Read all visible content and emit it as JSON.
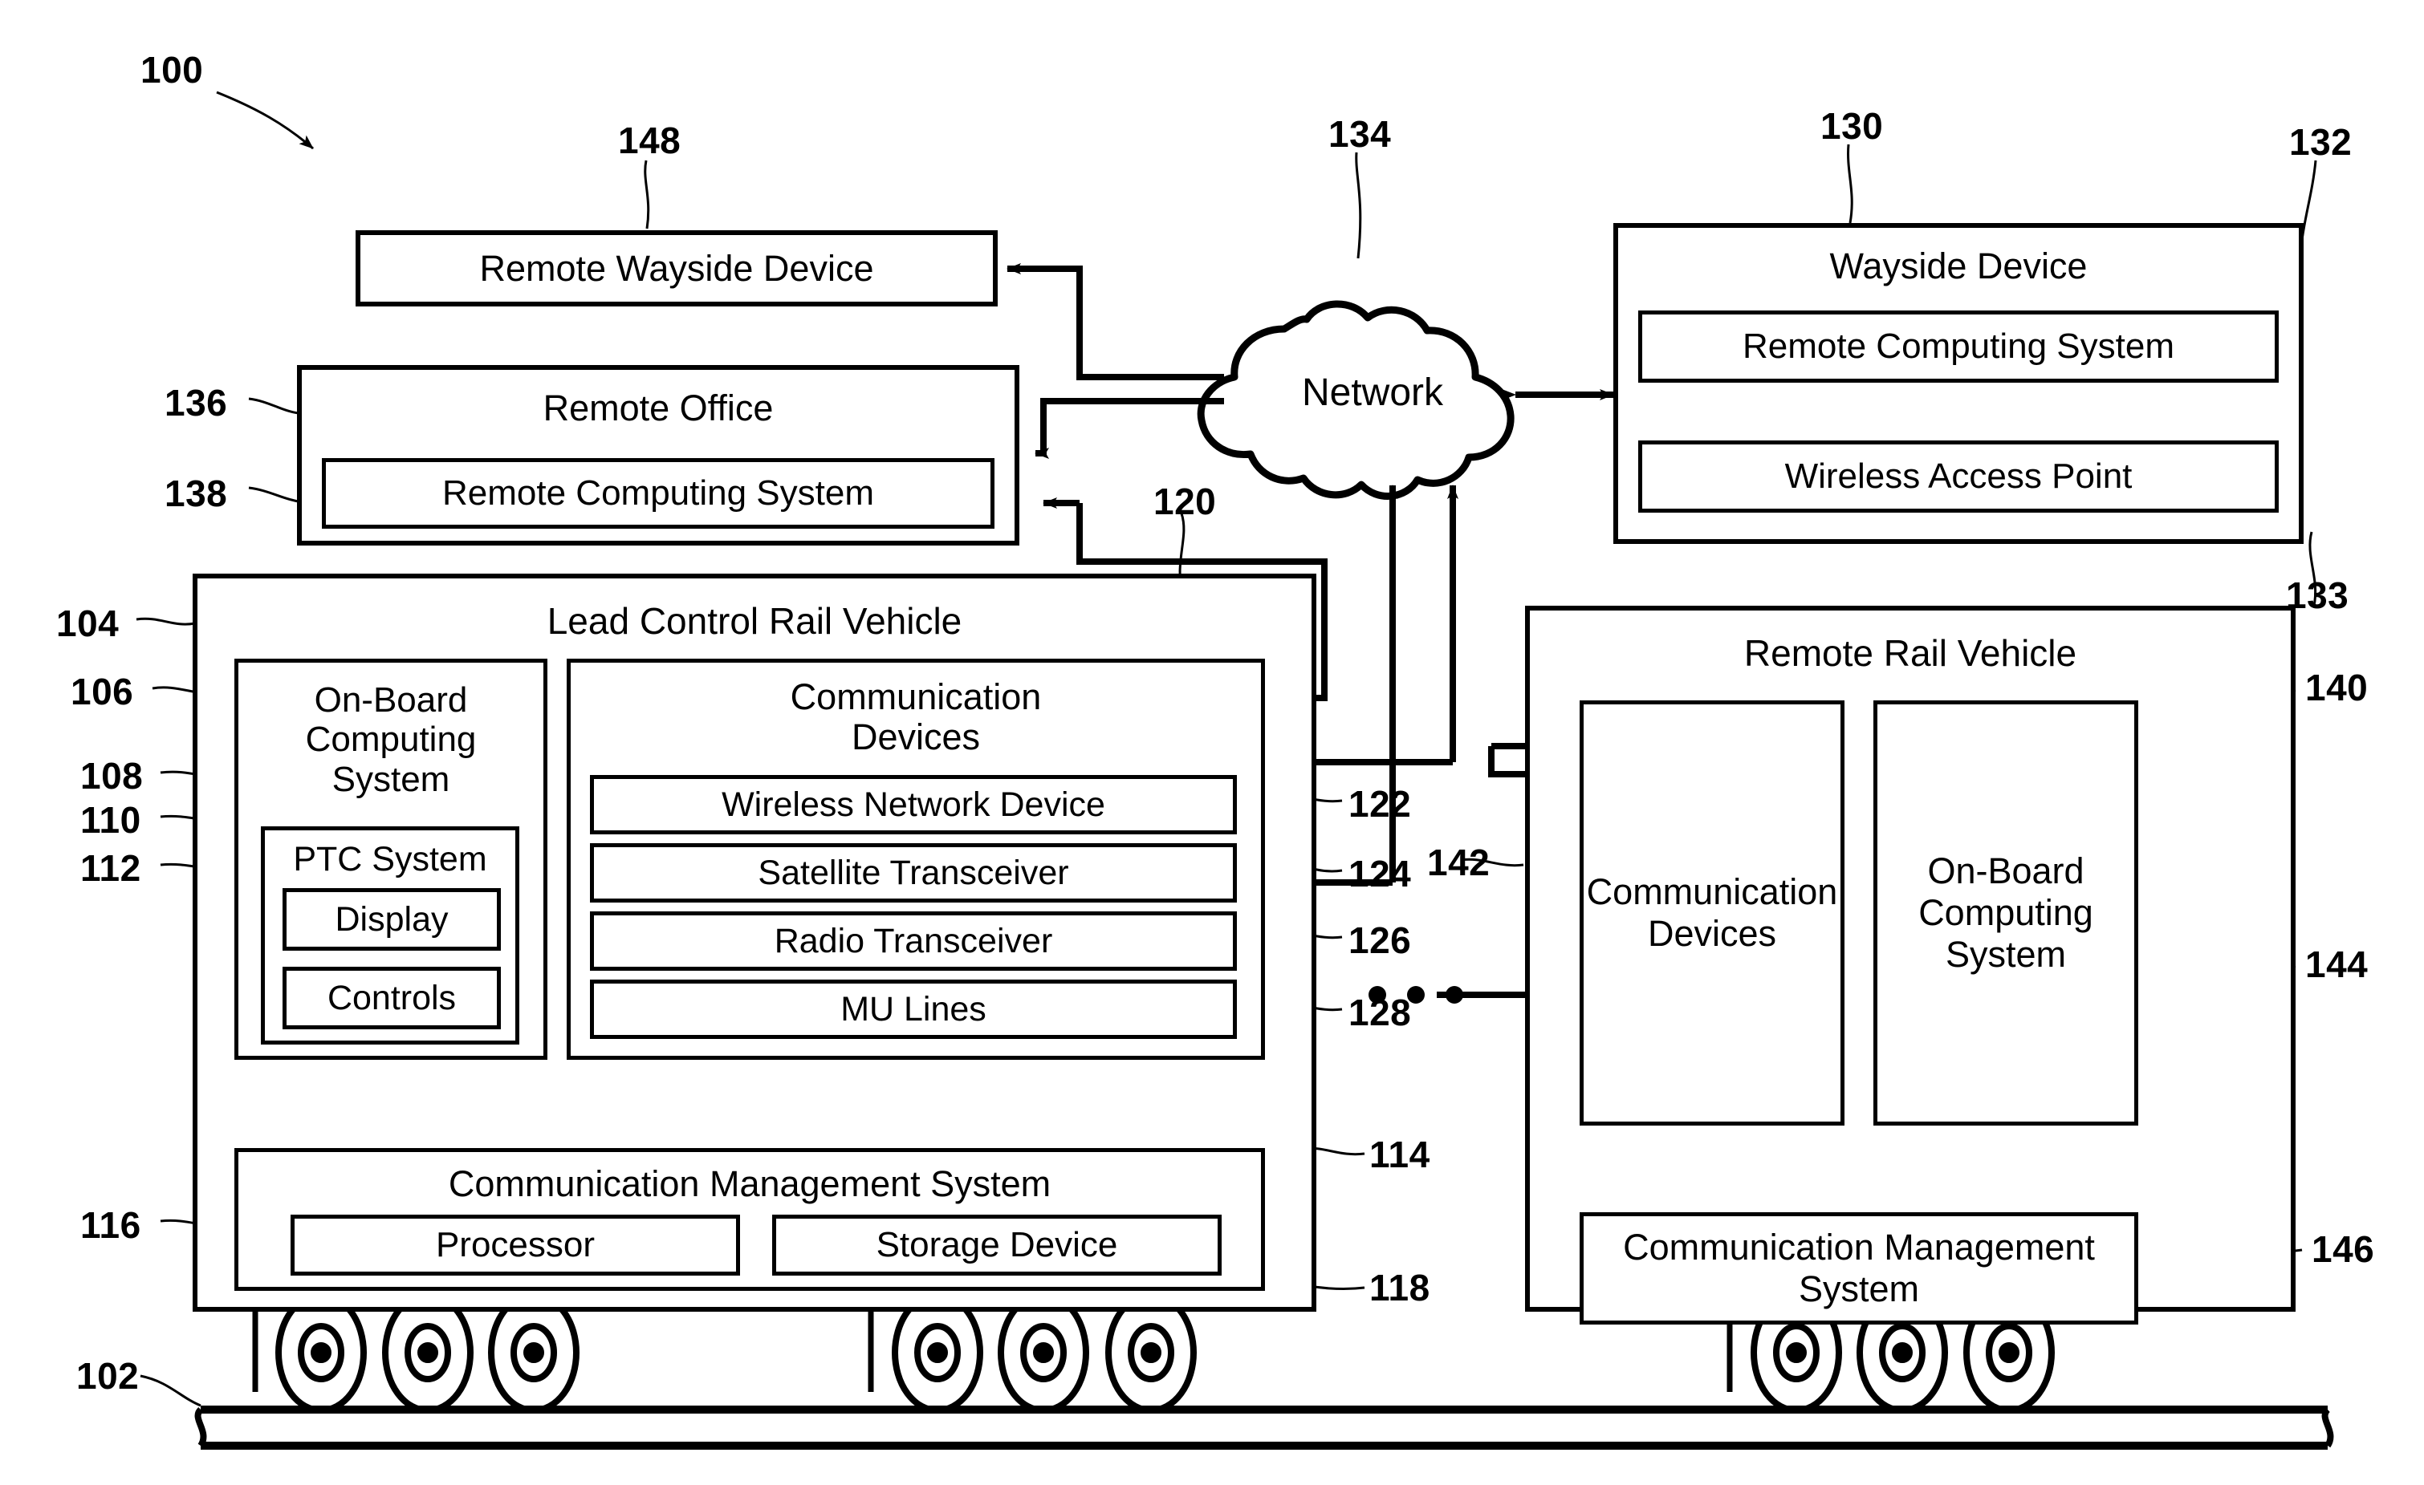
{
  "figure": {
    "id": "100",
    "type": "patent-block-diagram",
    "title_ref": "100"
  },
  "reference_numerals": [
    {
      "id": "100",
      "label": "100"
    },
    {
      "id": "148",
      "label": "148"
    },
    {
      "id": "134",
      "label": "134"
    },
    {
      "id": "130",
      "label": "130"
    },
    {
      "id": "132",
      "label": "132"
    },
    {
      "id": "133",
      "label": "133"
    },
    {
      "id": "136",
      "label": "136"
    },
    {
      "id": "138",
      "label": "138"
    },
    {
      "id": "120",
      "label": "120"
    },
    {
      "id": "104",
      "label": "104"
    },
    {
      "id": "106",
      "label": "106"
    },
    {
      "id": "108",
      "label": "108"
    },
    {
      "id": "110",
      "label": "110"
    },
    {
      "id": "112",
      "label": "112"
    },
    {
      "id": "122",
      "label": "122"
    },
    {
      "id": "124",
      "label": "124"
    },
    {
      "id": "126",
      "label": "126"
    },
    {
      "id": "128",
      "label": "128"
    },
    {
      "id": "114",
      "label": "114"
    },
    {
      "id": "116",
      "label": "116"
    },
    {
      "id": "118",
      "label": "118"
    },
    {
      "id": "102",
      "label": "102"
    },
    {
      "id": "140",
      "label": "140"
    },
    {
      "id": "142",
      "label": "142"
    },
    {
      "id": "144",
      "label": "144"
    },
    {
      "id": "146",
      "label": "146"
    }
  ],
  "blocks": {
    "remote_wayside_device": "Remote Wayside Device",
    "network": "Network",
    "wayside_device": "Wayside Device",
    "wayside_remote_computing_system": "Remote Computing System",
    "wireless_access_point": "Wireless Access Point",
    "remote_office": "Remote Office",
    "office_remote_computing_system": "Remote Computing System",
    "lead_control_rail_vehicle": "Lead Control Rail Vehicle",
    "onboard_computing_system": "On-Board\nComputing\nSystem",
    "ptc_system": "PTC System",
    "display": "Display",
    "controls": "Controls",
    "communication_devices": "Communication\nDevices",
    "wireless_network_device": "Wireless Network Device",
    "satellite_transceiver": "Satellite Transceiver",
    "radio_transceiver": "Radio Transceiver",
    "mu_lines": "MU Lines",
    "communication_management_system": "Communication Management System",
    "processor": "Processor",
    "storage_device": "Storage Device",
    "remote_rail_vehicle": "Remote Rail Vehicle",
    "remote_communication_devices": "Communication\nDevices",
    "remote_onboard_computing_system": "On-Board\nComputing\nSystem",
    "remote_communication_management_system": "Communication\nManagement System"
  },
  "ellipsis": "• • •",
  "colors": {
    "stroke": "#000000",
    "background": "#ffffff"
  }
}
